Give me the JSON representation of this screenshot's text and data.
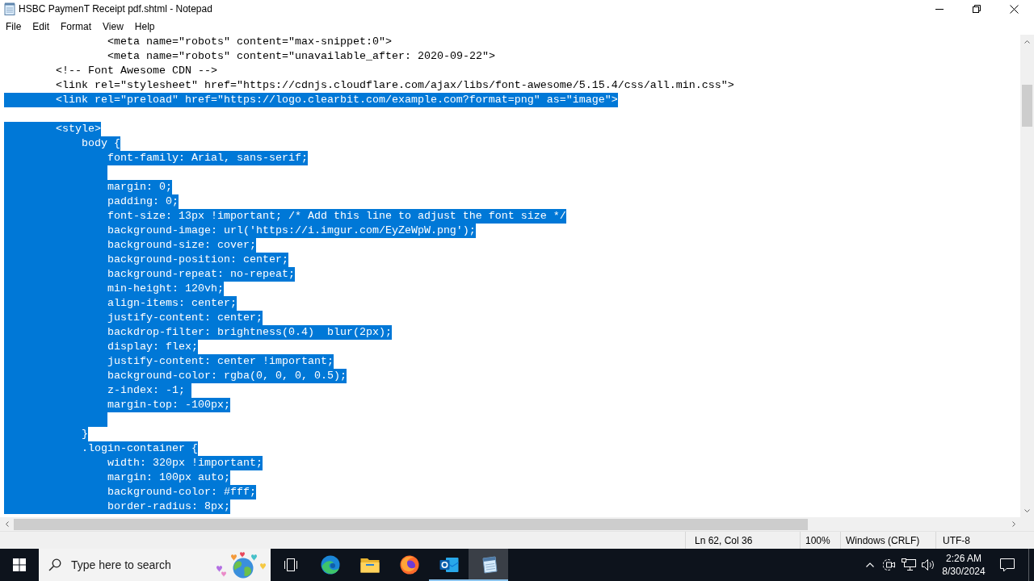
{
  "window": {
    "title": "HSBC PaymenT Receipt pdf.shtml - Notepad"
  },
  "menu": [
    "File",
    "Edit",
    "Format",
    "View",
    "Help"
  ],
  "lines": [
    {
      "kind": "code",
      "text": "                <meta name=\"robots\" content=\"max-snippet:0\">",
      "selected": false
    },
    {
      "kind": "code",
      "text": "                <meta name=\"robots\" content=\"unavailable_after: 2020-09-22\">",
      "selected": false
    },
    {
      "kind": "code",
      "text": "        <!-- Font Awesome CDN -->",
      "selected": false
    },
    {
      "kind": "code",
      "text": "        <link rel=\"stylesheet\" href=\"https://cdnjs.cloudflare.com/ajax/libs/font-awesome/5.15.4/css/all.min.css\">",
      "selected": false
    },
    {
      "kind": "code",
      "text": "        <link rel=\"preload\" href=\"https://logo.clearbit.com/example.com?format=png\" as=\"image\">",
      "selected": true
    },
    {
      "kind": "blank"
    },
    {
      "kind": "code",
      "text": "        <style>",
      "selected": true
    },
    {
      "kind": "code",
      "text": "            body {",
      "selected": true
    },
    {
      "kind": "code",
      "text": "                font-family: Arial, sans-serif;",
      "selected": true
    },
    {
      "kind": "indent",
      "selected": true
    },
    {
      "kind": "code",
      "text": "                margin: 0;",
      "selected": true
    },
    {
      "kind": "code",
      "text": "                padding: 0;",
      "selected": true
    },
    {
      "kind": "code",
      "text": "                font-size: 13px !important; /* Add this line to adjust the font size */",
      "selected": true
    },
    {
      "kind": "code",
      "text": "                background-image: url('https://i.imgur.com/EyZeWpW.png');",
      "selected": true
    },
    {
      "kind": "code",
      "text": "                background-size: cover;",
      "selected": true
    },
    {
      "kind": "code",
      "text": "                background-position: center;",
      "selected": true
    },
    {
      "kind": "code",
      "text": "                background-repeat: no-repeat;",
      "selected": true
    },
    {
      "kind": "code",
      "text": "                min-height: 120vh;",
      "selected": true
    },
    {
      "kind": "code",
      "text": "                align-items: center;",
      "selected": true
    },
    {
      "kind": "code",
      "text": "                justify-content: center;",
      "selected": true
    },
    {
      "kind": "code",
      "text": "                backdrop-filter: brightness(0.4)  blur(2px);",
      "selected": true
    },
    {
      "kind": "code",
      "text": "                display: flex;",
      "selected": true
    },
    {
      "kind": "code",
      "text": "                justify-content: center !important;",
      "selected": true
    },
    {
      "kind": "code",
      "text": "                background-color: rgba(0, 0, 0, 0.5);",
      "selected": true
    },
    {
      "kind": "code",
      "text": "                z-index: -1; ",
      "selected": true
    },
    {
      "kind": "code",
      "text": "                margin-top: -100px;",
      "selected": true
    },
    {
      "kind": "indent",
      "selected": true
    },
    {
      "kind": "code",
      "text": "            }",
      "selected": true
    },
    {
      "kind": "code",
      "text": "            .login-container {",
      "selected": true
    },
    {
      "kind": "code",
      "text": "                width: 320px !important;",
      "selected": true
    },
    {
      "kind": "code",
      "text": "                margin: 100px auto;",
      "selected": true
    },
    {
      "kind": "code",
      "text": "                background-color: #fff;",
      "selected": true
    },
    {
      "kind": "code",
      "text": "                border-radius: 8px;",
      "selected": true
    }
  ],
  "status_bar": {
    "cursor": "Ln 62, Col 36",
    "zoom": "100%",
    "line_endings": "Windows (CRLF)",
    "encoding": "UTF-8"
  },
  "taskbar": {
    "search": {
      "placeholder": "Type here to search"
    },
    "apps": [
      {
        "running": false,
        "selected": false
      },
      {
        "running": false,
        "selected": false
      },
      {
        "running": false,
        "selected": false
      },
      {
        "running": true,
        "selected": false
      },
      {
        "running": true,
        "selected": true
      }
    ],
    "clock": {
      "time": "2:26 AM",
      "date": "8/30/2024"
    }
  }
}
